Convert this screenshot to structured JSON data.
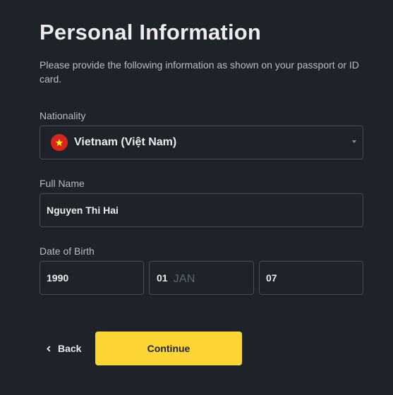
{
  "form": {
    "title": "Personal Information",
    "description": "Please provide the following information as shown on your passport or ID card."
  },
  "nationality": {
    "label": "Nationality",
    "value": "Vietnam (Việt Nam)",
    "flag_icon": "vietnam-flag-icon",
    "dropdown_icon": "caret-down-icon"
  },
  "full_name": {
    "label": "Full Name",
    "value": "Nguyen Thi Hai"
  },
  "date_of_birth": {
    "label": "Date of Birth",
    "year": "1990",
    "month": "01",
    "month_name": "JAN",
    "day": "07"
  },
  "actions": {
    "back_label": "Back",
    "back_icon": "chevron-left-icon",
    "continue_label": "Continue"
  },
  "colors": {
    "background": "#1e2329",
    "primary_text": "#eaecef",
    "secondary_text": "#b7bdc6",
    "field_border": "#474d57",
    "accent": "#fcd535",
    "flag_red": "#da251d",
    "flag_star": "#ffff00"
  }
}
